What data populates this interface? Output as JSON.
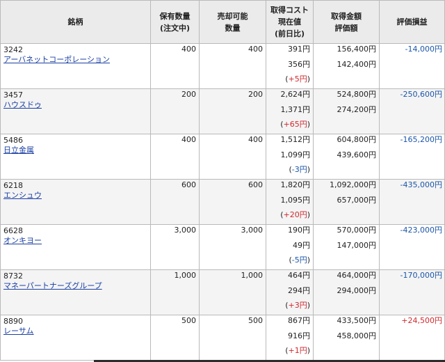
{
  "headers": {
    "name": "銘柄",
    "qty": [
      "保有数量",
      "(注文中)"
    ],
    "sellable": [
      "売却可能",
      "数量"
    ],
    "cost": [
      "取得コスト",
      "現在値",
      "(前日比)"
    ],
    "amount": [
      "取得金額",
      "評価額"
    ],
    "pl": "評価損益"
  },
  "rows": [
    {
      "code": "3242",
      "name": "アーバネットコーポレーション",
      "qty": "400",
      "sellable": "400",
      "cost": "391円",
      "price": "356円",
      "change": "+5円",
      "change_sign": "pos",
      "acq_amount": "156,400円",
      "eval_amount": "142,400円",
      "pl": "-14,000円",
      "pl_sign": "neg"
    },
    {
      "code": "3457",
      "name": "ハウスドゥ",
      "qty": "200",
      "sellable": "200",
      "cost": "2,624円",
      "price": "1,371円",
      "change": "+65円",
      "change_sign": "pos",
      "acq_amount": "524,800円",
      "eval_amount": "274,200円",
      "pl": "-250,600円",
      "pl_sign": "neg"
    },
    {
      "code": "5486",
      "name": "日立金属",
      "qty": "400",
      "sellable": "400",
      "cost": "1,512円",
      "price": "1,099円",
      "change": "-3円",
      "change_sign": "neg",
      "acq_amount": "604,800円",
      "eval_amount": "439,600円",
      "pl": "-165,200円",
      "pl_sign": "neg"
    },
    {
      "code": "6218",
      "name": "エンシュウ",
      "qty": "600",
      "sellable": "600",
      "cost": "1,820円",
      "price": "1,095円",
      "change": "+20円",
      "change_sign": "pos",
      "acq_amount": "1,092,000円",
      "eval_amount": "657,000円",
      "pl": "-435,000円",
      "pl_sign": "neg"
    },
    {
      "code": "6628",
      "name": "オンキヨー",
      "qty": "3,000",
      "sellable": "3,000",
      "cost": "190円",
      "price": "49円",
      "change": "-5円",
      "change_sign": "neg",
      "acq_amount": "570,000円",
      "eval_amount": "147,000円",
      "pl": "-423,000円",
      "pl_sign": "neg"
    },
    {
      "code": "8732",
      "name": "マネーパートナーズグループ",
      "qty": "1,000",
      "sellable": "1,000",
      "cost": "464円",
      "price": "294円",
      "change": "+3円",
      "change_sign": "pos",
      "acq_amount": "464,000円",
      "eval_amount": "294,000円",
      "pl": "-170,000円",
      "pl_sign": "neg"
    },
    {
      "code": "8890",
      "name": "レーサム",
      "qty": "500",
      "sellable": "500",
      "cost": "867円",
      "price": "916円",
      "change": "+1円",
      "change_sign": "pos",
      "acq_amount": "433,500円",
      "eval_amount": "458,000円",
      "pl": "+24,500円",
      "pl_sign": "pos"
    }
  ],
  "colors": {
    "negative": "#1a55a8",
    "positive": "#d0282e",
    "link": "#1a3fa3",
    "header_bg": "#ebebeb"
  }
}
